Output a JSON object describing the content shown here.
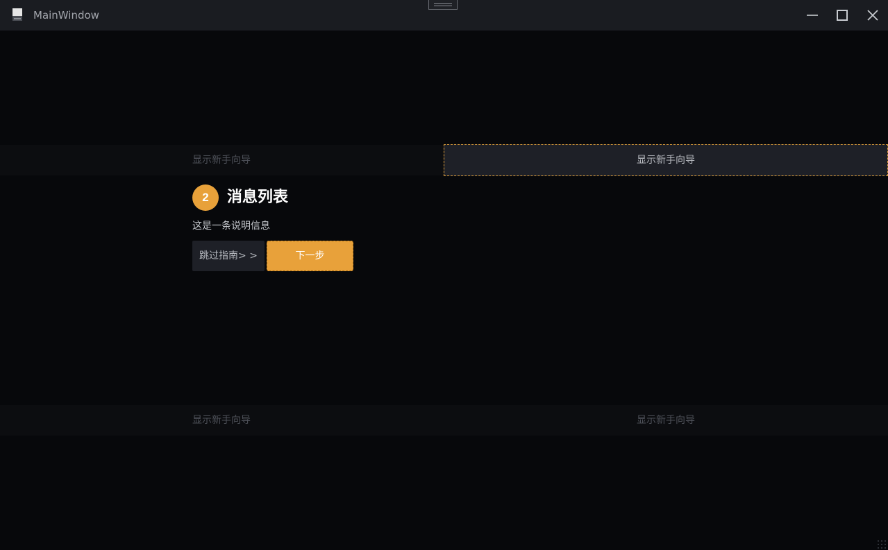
{
  "window": {
    "title": "MainWindow",
    "controls": {
      "minimize_icon": "minimize-icon",
      "maximize_icon": "maximize-icon",
      "close_icon": "close-icon"
    }
  },
  "bands": {
    "top": {
      "left_label": "显示新手向导",
      "right_label": "显示新手向导"
    },
    "bottom": {
      "left_label": "显示新手向导",
      "right_label": "显示新手向导"
    }
  },
  "guide": {
    "step_number": "2",
    "title": "消息列表",
    "description": "这是一条说明信息",
    "skip_label": "跳过指南> >",
    "next_label": "下一步"
  },
  "colors": {
    "background": "#07080b",
    "titlebar": "#1a1c21",
    "accent": "#e8a13a",
    "highlight_border": "#e3a13b"
  }
}
